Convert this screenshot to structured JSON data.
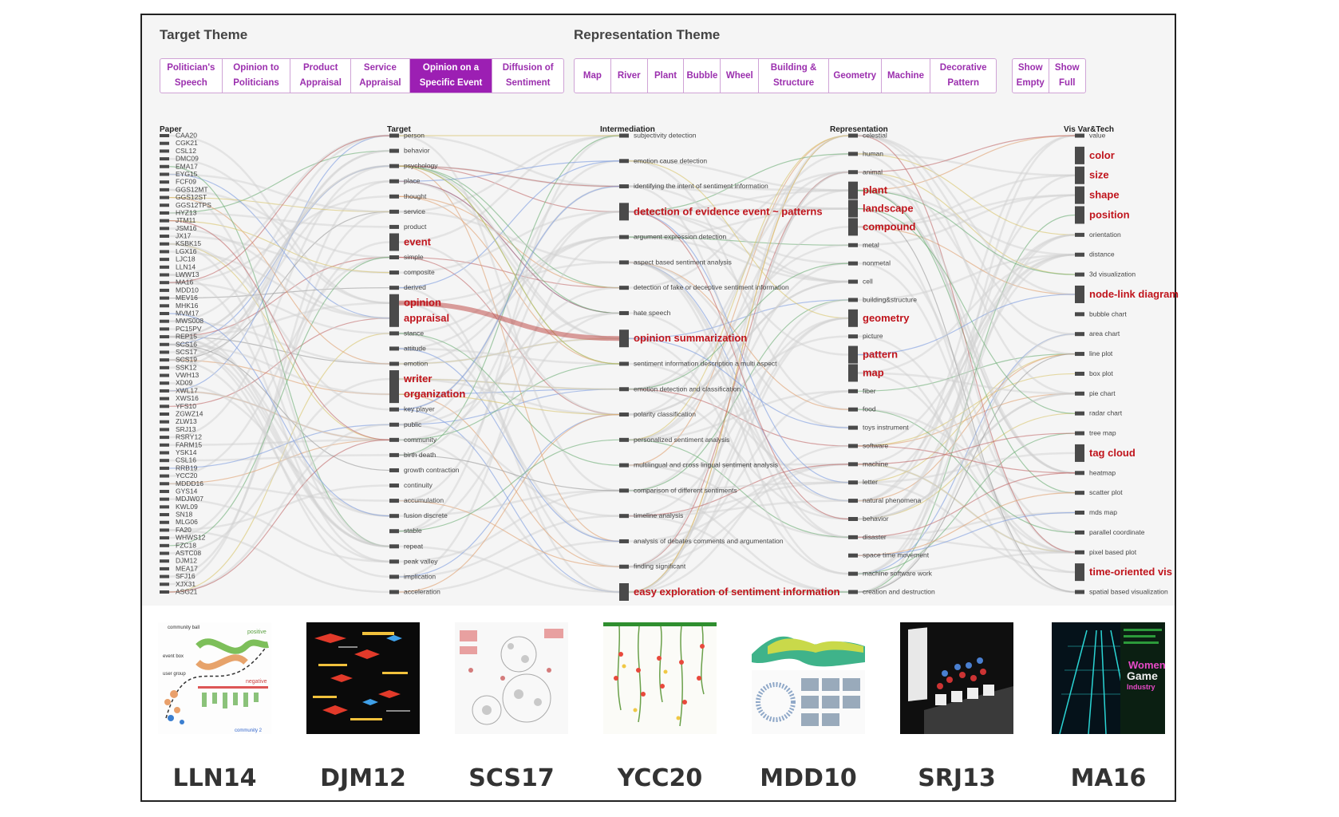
{
  "target_theme": {
    "title": "Target Theme",
    "buttons": [
      {
        "l1": "Politician's",
        "l2": "Speech",
        "w": 0
      },
      {
        "l1": "Opinion to",
        "l2": "Politicians"
      },
      {
        "l1": "Product",
        "l2": "Appraisal"
      },
      {
        "l1": "Service",
        "l2": "Appraisal"
      },
      {
        "l1": "Opinion on a",
        "l2": "Specific Event"
      },
      {
        "l1": "Diffusion of",
        "l2": "Sentiment"
      }
    ],
    "active_index": 4
  },
  "representation_theme": {
    "title": "Representation Theme",
    "buttons": [
      "Map",
      "River",
      "Plant",
      "Bubble",
      "Wheel",
      "Building & Structure",
      "Geometry",
      "Machine",
      "Decorative Pattern"
    ],
    "show_buttons": [
      {
        "l1": "Show",
        "l2": "Empty"
      },
      {
        "l1": "Show",
        "l2": "Full"
      }
    ]
  },
  "columns": [
    "Paper",
    "Target",
    "Intermediation",
    "Representation",
    "Vis Var&Tech"
  ],
  "papers": [
    "CAA20",
    "CGK21",
    "CSL12",
    "DMC09",
    "EMA17",
    "EYG15",
    "FCF09",
    "GGS12MT",
    "GGS12ST",
    "GGS12TPS",
    "HYZ13",
    "JTM11",
    "JSM16",
    "JX17",
    "KSBK15",
    "LGX16",
    "LJC18",
    "LLN14",
    "LWW13",
    "MA16",
    "MDD10",
    "MEV16",
    "MHK16",
    "MVM17",
    "MWS008",
    "PC15PV",
    "REP15",
    "SCS16",
    "SCS17",
    "SCS19",
    "SSK12",
    "VWH13",
    "XD09",
    "XWL17",
    "XWS16",
    "YFS10",
    "ZGWZ14",
    "ZLW13",
    "SRJ13",
    "RSRY12",
    "FARM15",
    "YSK14",
    "CSL16",
    "RRB19",
    "YCC20",
    "MDDD16",
    "GYS14",
    "MDJW07",
    "KWL09",
    "SN18",
    "MLG06",
    "FA20",
    "WHWS12",
    "FZC18",
    "ASTC08",
    "DJM12",
    "MEA17",
    "SFJ16",
    "XJX31",
    "ASG21"
  ],
  "targets": [
    {
      "t": "person",
      "h": false
    },
    {
      "t": "behavior",
      "h": false
    },
    {
      "t": "psychology",
      "h": false
    },
    {
      "t": "place",
      "h": false
    },
    {
      "t": "thought",
      "h": false
    },
    {
      "t": "service",
      "h": false
    },
    {
      "t": "product",
      "h": false
    },
    {
      "t": "event",
      "h": true
    },
    {
      "t": "simple",
      "h": false
    },
    {
      "t": "composite",
      "h": false
    },
    {
      "t": "derived",
      "h": false
    },
    {
      "t": "opinion",
      "h": true
    },
    {
      "t": "appraisal",
      "h": true
    },
    {
      "t": "stance",
      "h": false
    },
    {
      "t": "attitude",
      "h": false
    },
    {
      "t": "emotion",
      "h": false
    },
    {
      "t": "writer",
      "h": true
    },
    {
      "t": "organization",
      "h": true
    },
    {
      "t": "key player",
      "h": false
    },
    {
      "t": "public",
      "h": false
    },
    {
      "t": "community",
      "h": false
    },
    {
      "t": "birth death",
      "h": false
    },
    {
      "t": "growth contraction",
      "h": false
    },
    {
      "t": "continuity",
      "h": false
    },
    {
      "t": "accumulation",
      "h": false
    },
    {
      "t": "fusion discrete",
      "h": false
    },
    {
      "t": "stable",
      "h": false
    },
    {
      "t": "repeat",
      "h": false
    },
    {
      "t": "peak valley",
      "h": false
    },
    {
      "t": "implication",
      "h": false
    },
    {
      "t": "acceleration",
      "h": false
    }
  ],
  "intermediations": [
    {
      "t": "subjectivity detection",
      "h": false
    },
    {
      "t": "emotion cause detection",
      "h": false
    },
    {
      "t": "identifying the intent of sentiment information",
      "h": false
    },
    {
      "t": "detection of evidence event ~ patterns",
      "h": true
    },
    {
      "t": "argument expression detection",
      "h": false
    },
    {
      "t": "aspect based sentiment analysis",
      "h": false
    },
    {
      "t": "detection of fake or deceptive sentiment information",
      "h": false
    },
    {
      "t": "hate speech",
      "h": false
    },
    {
      "t": "opinion summarization",
      "h": true
    },
    {
      "t": "sentiment information description a multi aspect",
      "h": false
    },
    {
      "t": "emotion detection and classification",
      "h": false
    },
    {
      "t": "polarity classification",
      "h": false
    },
    {
      "t": "personalized sentiment analysis",
      "h": false
    },
    {
      "t": "multilingual and cross lingual sentiment analysis",
      "h": false
    },
    {
      "t": "comparison of different sentiments",
      "h": false
    },
    {
      "t": "timeline analysis",
      "h": false
    },
    {
      "t": "analysis of debates comments and argumentation",
      "h": false
    },
    {
      "t": "finding significant",
      "h": false
    },
    {
      "t": "easy exploration of sentiment information",
      "h": true
    }
  ],
  "representations": [
    {
      "t": "celestial",
      "h": false
    },
    {
      "t": "human",
      "h": false
    },
    {
      "t": "animal",
      "h": false
    },
    {
      "t": "plant",
      "h": true
    },
    {
      "t": "landscape",
      "h": true
    },
    {
      "t": "compound",
      "h": true
    },
    {
      "t": "metal",
      "h": false
    },
    {
      "t": "nonmetal",
      "h": false
    },
    {
      "t": "cell",
      "h": false
    },
    {
      "t": "building&structure",
      "h": false
    },
    {
      "t": "geometry",
      "h": true
    },
    {
      "t": "picture",
      "h": false
    },
    {
      "t": "pattern",
      "h": true
    },
    {
      "t": "map",
      "h": true
    },
    {
      "t": "fiber",
      "h": false
    },
    {
      "t": "food",
      "h": false
    },
    {
      "t": "toys instrument",
      "h": false
    },
    {
      "t": "software",
      "h": false
    },
    {
      "t": "machine",
      "h": false
    },
    {
      "t": "letter",
      "h": false
    },
    {
      "t": "natural phenomena",
      "h": false
    },
    {
      "t": "behavior",
      "h": false
    },
    {
      "t": "disaster",
      "h": false
    },
    {
      "t": "space time movement",
      "h": false
    },
    {
      "t": "machine software work",
      "h": false
    },
    {
      "t": "creation and destruction",
      "h": false
    }
  ],
  "visvars": [
    {
      "t": "value",
      "h": false
    },
    {
      "t": "color",
      "h": true
    },
    {
      "t": "size",
      "h": true
    },
    {
      "t": "shape",
      "h": true
    },
    {
      "t": "position",
      "h": true
    },
    {
      "t": "orientation",
      "h": false
    },
    {
      "t": "distance",
      "h": false
    },
    {
      "t": "3d visualization",
      "h": false
    },
    {
      "t": "node-link diagram",
      "h": true
    },
    {
      "t": "bubble chart",
      "h": false
    },
    {
      "t": "area chart",
      "h": false
    },
    {
      "t": "line plot",
      "h": false
    },
    {
      "t": "box plot",
      "h": false
    },
    {
      "t": "pie chart",
      "h": false
    },
    {
      "t": "radar chart",
      "h": false
    },
    {
      "t": "tree map",
      "h": false
    },
    {
      "t": "tag cloud",
      "h": true
    },
    {
      "t": "heatmap",
      "h": false
    },
    {
      "t": "scatter plot",
      "h": false
    },
    {
      "t": "mds map",
      "h": false
    },
    {
      "t": "parallel coordinate",
      "h": false
    },
    {
      "t": "pixel based plot",
      "h": false
    },
    {
      "t": "time-oriented vis",
      "h": true
    },
    {
      "t": "spatial based visualization",
      "h": false
    }
  ],
  "examples": [
    "LLN14",
    "DJM12",
    "SCS17",
    "YCC20",
    "MDD10",
    "SRJ13",
    "MA16"
  ],
  "thumb_texts": {
    "lln14": [
      "community ball",
      "event box",
      "user group",
      "positive",
      "negative",
      "community 2"
    ],
    "ma16": [
      "Women",
      "Game",
      "Industry"
    ]
  },
  "colors": {
    "accent": "#9c1fb3",
    "highlight": "#c0141c",
    "node": "#4a4a4a"
  }
}
